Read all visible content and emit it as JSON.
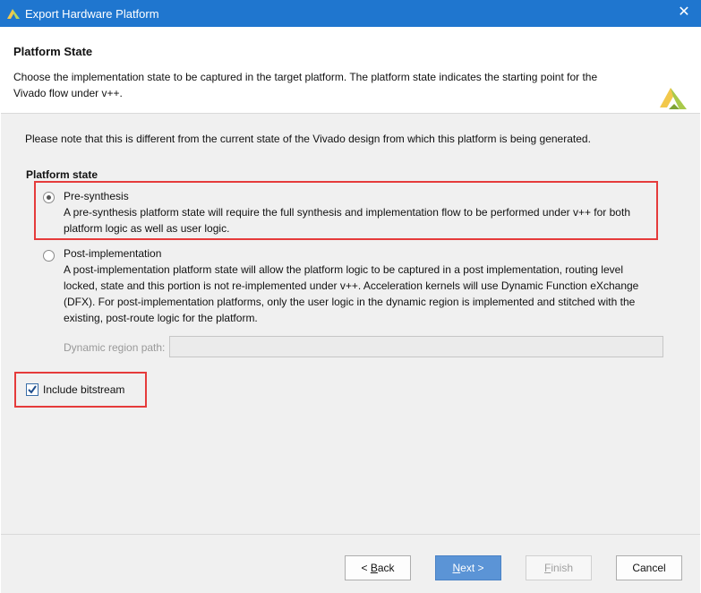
{
  "window": {
    "title": "Export Hardware Platform",
    "close_icon": "close-icon"
  },
  "header": {
    "heading": "Platform State",
    "description": "Choose the implementation state to be captured in the target platform. The platform state indicates the starting point for the Vivado flow under v++.",
    "logo_icon": "vivado-logo-icon"
  },
  "content": {
    "note": "Please note that this is different from the current state of the Vivado design from which this platform is being generated.",
    "group_title": "Platform state",
    "options": [
      {
        "label": "Pre-synthesis",
        "selected": true,
        "description": "A pre-synthesis platform state will require the full synthesis and implementation flow to be performed under v++ for both platform logic as well as user logic."
      },
      {
        "label": "Post-implementation",
        "selected": false,
        "description": "A post-implementation platform state will allow the platform logic to be captured in a post implementation, routing level locked, state and this portion is not re-implemented under v++. Acceleration kernels will use Dynamic Function eXchange (DFX). For post-implementation platforms, only the user logic in the dynamic region is implemented and stitched with the existing, post-route logic for the platform."
      }
    ],
    "dynamic_region": {
      "label": "Dynamic region path:",
      "value": ""
    },
    "include_bitstream": {
      "label": "Include bitstream",
      "checked": true
    }
  },
  "footer": {
    "back": {
      "prefix": "< ",
      "mnemonic": "B",
      "rest": "ack"
    },
    "next": {
      "mnemonic": "N",
      "rest": "ext >"
    },
    "finish": {
      "mnemonic": "F",
      "rest": "inish"
    },
    "cancel": "Cancel"
  },
  "colors": {
    "titlebar": "#1f76cf",
    "highlight": "#e53b3b",
    "primary_button": "#5b94d6"
  }
}
